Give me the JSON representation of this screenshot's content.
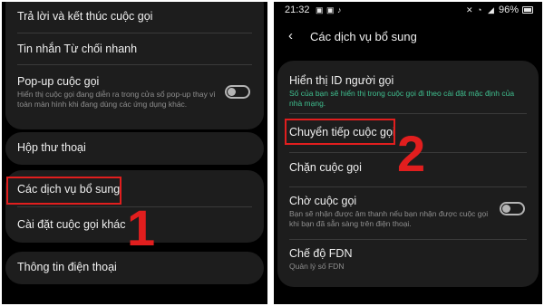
{
  "left": {
    "card1": {
      "answer_end": "Trả lời và kết thúc cuộc gọi",
      "quick_decline": "Tin nhắn Từ chối nhanh",
      "popup_title": "Pop-up cuộc gọi",
      "popup_desc": "Hiển thị cuộc gọi đang diễn ra trong cửa sổ pop-up thay vì toàn màn hình khi đang dùng các ứng dụng khác.",
      "popup_toggle_on": false
    },
    "voicemail": "Hộp thư thoại",
    "card3": {
      "supplementary": "Các dịch vụ bổ sung",
      "more_settings": "Cài đặt cuộc gọi khác"
    },
    "phone_info": "Thông tin điện thoại",
    "step_number": "1"
  },
  "right": {
    "status": {
      "time": "21:32",
      "battery": "96%",
      "battery_level": 0.96
    },
    "header": {
      "title": "Các dịch vụ bổ sung"
    },
    "items": {
      "caller_id_title": "Hiển thị ID người gọi",
      "caller_id_desc": "Số của bạn sẽ hiển thị trong cuộc gọi đi theo cài đặt mặc định của nhà mạng.",
      "forwarding": "Chuyển tiếp cuộc gọi",
      "barring": "Chặn cuộc gọi",
      "waiting_title": "Chờ cuộc gọi",
      "waiting_desc": "Bạn sẽ nhận được âm thanh nếu bạn nhận được cuộc gọi khi bạn đã sẵn sàng trên điện thoại.",
      "waiting_toggle_on": false,
      "fdn_title": "Chế độ FDN",
      "fdn_desc": "Quản lý số FDN"
    },
    "step_number": "2"
  },
  "colors": {
    "highlight": "#e11e1e",
    "card": "#1d1d1d",
    "accent_green": "#3fbf8f"
  }
}
